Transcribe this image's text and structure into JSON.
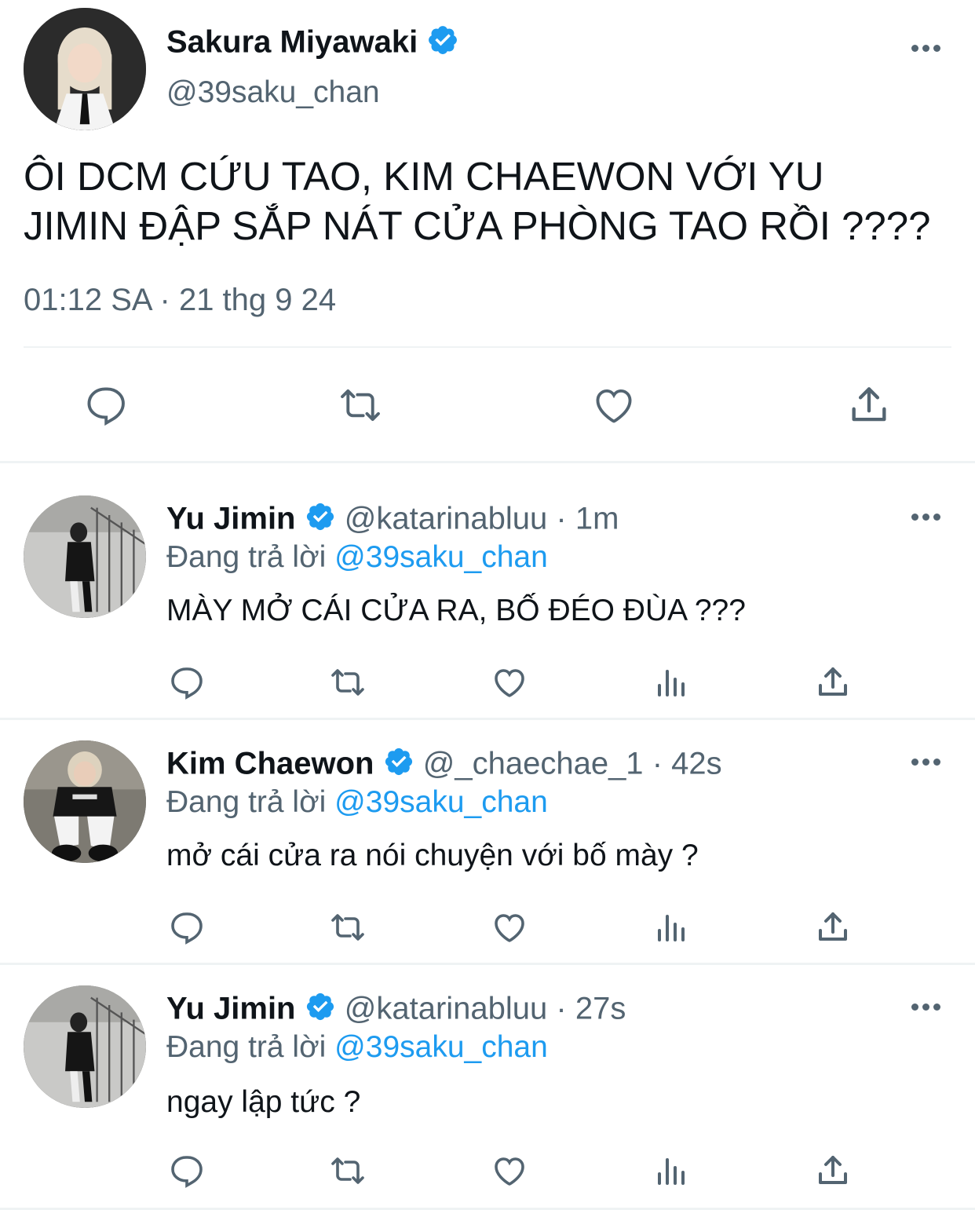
{
  "main_tweet": {
    "display_name": "Sakura Miyawaki",
    "handle": "@39saku_chan",
    "text_line1": "ÔI DCM CỨU TAO, KIM CHAEWON VỚI YU",
    "text_line2": "JIMIN ĐẬP SẮP NÁT CỬA PHÒNG TAO RỒI ????",
    "time": "01:12 SA",
    "separator": "·",
    "date": "21 thg 9 24"
  },
  "replies": [
    {
      "display_name": "Yu Jimin",
      "handle": "@katarinabluu",
      "separator": "·",
      "age": "1m",
      "replying_label": "Đang trả lời",
      "replying_to": "@39saku_chan",
      "text": "MÀY MỞ CÁI CỬA RA, BỐ ĐÉO ĐÙA ???"
    },
    {
      "display_name": "Kim Chaewon",
      "handle": "@_chaechae_1",
      "separator": "·",
      "age": "42s",
      "replying_label": "Đang trả lời",
      "replying_to": "@39saku_chan",
      "text": "mở cái cửa ra nói chuyện với bố mày ?"
    },
    {
      "display_name": "Yu Jimin",
      "handle": "@katarinabluu",
      "separator": "·",
      "age": "27s",
      "replying_label": "Đang trả lời",
      "replying_to": "@39saku_chan",
      "text": "ngay lập tức ?"
    }
  ],
  "icons": {
    "reply": "reply-icon",
    "retweet": "retweet-icon",
    "like": "heart-icon",
    "views": "views-icon",
    "share": "share-icon",
    "verified": "verified-badge-icon",
    "more": "more-icon"
  },
  "colors": {
    "text": "#0f1419",
    "secondary": "#536471",
    "accent": "#1d9bf0",
    "divider": "#eff3f4"
  }
}
